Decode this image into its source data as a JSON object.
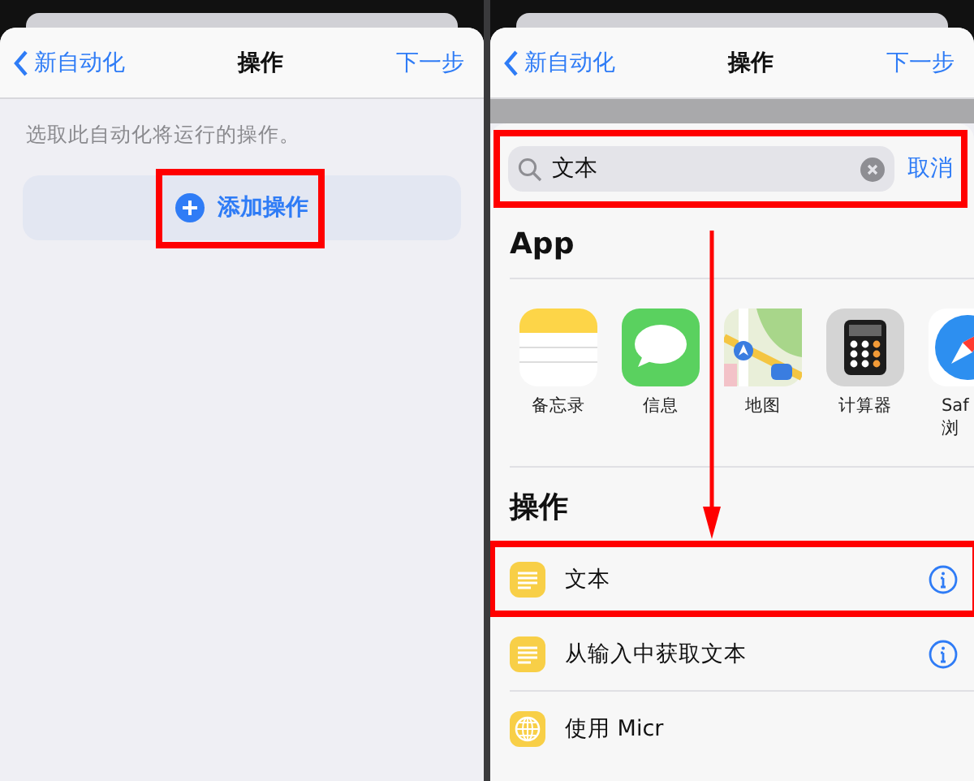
{
  "left": {
    "nav": {
      "back": "新自动化",
      "title": "操作",
      "next": "下一步"
    },
    "hint": "选取此自动化将运行的操作。",
    "add_button": {
      "label": "添加操作",
      "highlighted": true
    }
  },
  "right": {
    "nav": {
      "back": "新自动化",
      "title": "操作",
      "next": "下一步"
    },
    "search": {
      "value": "文本",
      "cancel": "取消",
      "highlighted": true
    },
    "apps_header": "App",
    "apps": [
      {
        "kind": "notes",
        "label": "备忘录"
      },
      {
        "kind": "messages",
        "label": "信息"
      },
      {
        "kind": "maps",
        "label": "地图"
      },
      {
        "kind": "calculator",
        "label": "计算器"
      },
      {
        "kind": "safari",
        "label": "Saf",
        "sublabel": "浏"
      }
    ],
    "actions_header": "操作",
    "actions": [
      {
        "kind": "text",
        "label": "文本",
        "info": true,
        "highlighted": true
      },
      {
        "kind": "text",
        "label": "从输入中获取文本",
        "info": true,
        "highlighted": false
      },
      {
        "kind": "web",
        "label": "使用 Micr",
        "info": false,
        "highlighted": false
      }
    ],
    "pointer_arrow": true
  }
}
